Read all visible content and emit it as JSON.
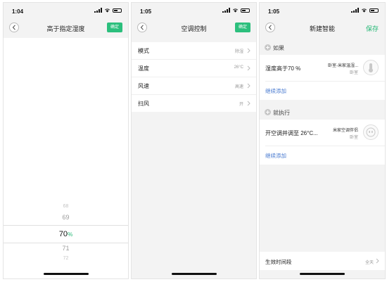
{
  "screen1": {
    "time": "1:04",
    "title": "高于指定湿度",
    "confirm": "确定",
    "picker": {
      "above2": "68",
      "above1": "69",
      "selected": "70",
      "unit": "%",
      "below1": "71",
      "below2": "72"
    }
  },
  "screen2": {
    "time": "1:05",
    "title": "空调控制",
    "confirm": "确定",
    "rows": [
      {
        "label": "模式",
        "value": "除湿"
      },
      {
        "label": "温度",
        "value": "26°C"
      },
      {
        "label": "风速",
        "value": "高速"
      },
      {
        "label": "扫风",
        "value": "开"
      }
    ]
  },
  "screen3": {
    "time": "1:05",
    "title": "新建智能",
    "save": "保存",
    "if_label": "如果",
    "condition": {
      "text": "湿度高于70 %",
      "device": "卧室-米家温湿...",
      "room": "卧室"
    },
    "add_more_1": "继续添加",
    "then_label": "就执行",
    "action": {
      "text": "开空调并调至 26°C...",
      "device": "米家空调伴侣",
      "room": "卧室"
    },
    "add_more_2": "继续添加",
    "effective_period": {
      "label": "生效时间段",
      "value": "全天"
    }
  },
  "colors": {
    "accent_green": "#2cbf7d",
    "link_blue": "#4a7bd0",
    "background": "#f3f3f3"
  },
  "icons": [
    "back-icon",
    "signal-icon",
    "wifi-icon",
    "battery-icon",
    "chevron-right-icon",
    "add-circle-icon",
    "hygrometer-icon",
    "ac-plug-icon"
  ]
}
